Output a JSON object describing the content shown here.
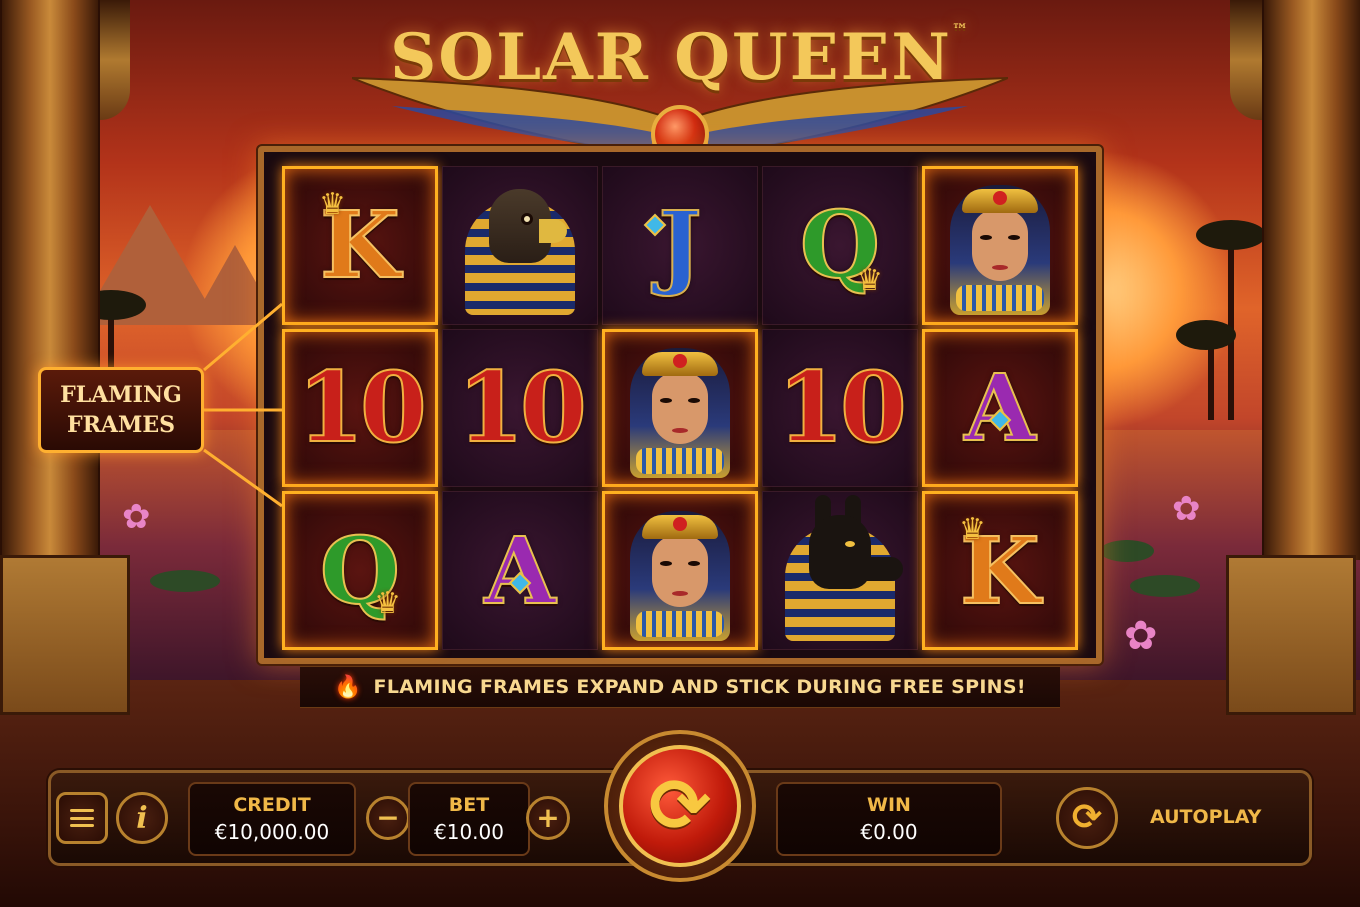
{
  "game": {
    "title": "SOLAR QUEEN",
    "trademark": "™"
  },
  "reels": [
    [
      {
        "symbol": "K",
        "type": "letter",
        "color": "k",
        "flaming": true,
        "icon": "crown-icon"
      },
      {
        "symbol": "10",
        "type": "letter",
        "color": "10",
        "flaming": true
      },
      {
        "symbol": "Q",
        "type": "letter",
        "color": "q",
        "flaming": true,
        "icon": "crown-icon"
      }
    ],
    [
      {
        "symbol": "horus",
        "type": "horus"
      },
      {
        "symbol": "10",
        "type": "letter",
        "color": "10"
      },
      {
        "symbol": "A",
        "type": "letter",
        "color": "a",
        "icon": "gem-icon"
      }
    ],
    [
      {
        "symbol": "J",
        "type": "letter",
        "color": "j",
        "icon": "gem-icon"
      },
      {
        "symbol": "queen",
        "type": "queen",
        "flaming": true
      },
      {
        "symbol": "queen",
        "type": "queen",
        "flaming": true
      }
    ],
    [
      {
        "symbol": "Q",
        "type": "letter",
        "color": "q",
        "icon": "crown-icon"
      },
      {
        "symbol": "10",
        "type": "letter",
        "color": "10"
      },
      {
        "symbol": "anubis",
        "type": "anubis"
      }
    ],
    [
      {
        "symbol": "queen",
        "type": "queen",
        "flaming": true
      },
      {
        "symbol": "A",
        "type": "letter",
        "color": "a",
        "flaming": true,
        "icon": "gem-icon"
      },
      {
        "symbol": "K",
        "type": "letter",
        "color": "k",
        "flaming": true,
        "icon": "crown-icon"
      }
    ]
  ],
  "callout": {
    "line1": "FLAMING",
    "line2": "FRAMES"
  },
  "banner": {
    "icon": "fire-icon",
    "text": "FLAMING FRAMES EXPAND AND STICK DURING FREE SPINS!"
  },
  "controls": {
    "menu_icon": "menu-icon",
    "info_label": "i",
    "credit": {
      "label": "CREDIT",
      "value": "€10,000.00"
    },
    "bet": {
      "label": "BET",
      "value": "€10.00",
      "minus": "−",
      "plus": "+"
    },
    "win": {
      "label": "WIN",
      "value": "€0.00"
    },
    "spin_icon": "spin-icon",
    "autoplay": {
      "label": "AUTOPLAY",
      "icon": "autoplay-icon"
    }
  },
  "colors": {
    "accent_gold": "#f0c050",
    "flame_frame": "#ffb020",
    "spin_red": "#c01a0a"
  }
}
